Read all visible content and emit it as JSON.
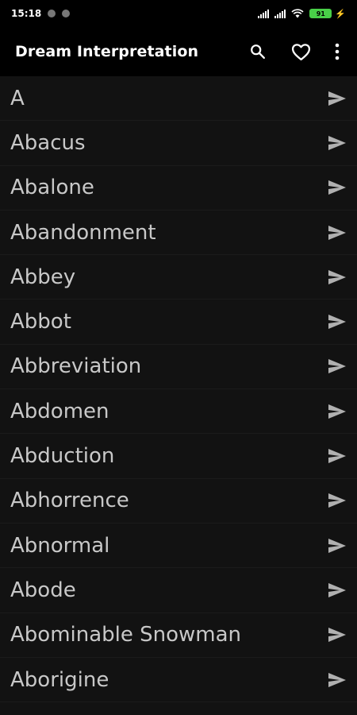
{
  "status_bar": {
    "time": "15:18",
    "battery": "91",
    "icons": [
      "notification-dot-icon",
      "notification-dot-icon",
      "signal-icon",
      "signal-icon",
      "wifi-icon",
      "battery-icon",
      "charging-icon"
    ]
  },
  "app_bar": {
    "title": "Dream Interpretation",
    "actions": [
      "search-icon",
      "heart-icon",
      "more-vert-icon"
    ]
  },
  "list": {
    "items": [
      {
        "label": "A"
      },
      {
        "label": "Abacus"
      },
      {
        "label": "Abalone"
      },
      {
        "label": "Abandonment"
      },
      {
        "label": "Abbey"
      },
      {
        "label": "Abbot"
      },
      {
        "label": "Abbreviation"
      },
      {
        "label": "Abdomen"
      },
      {
        "label": "Abduction"
      },
      {
        "label": "Abhorrence"
      },
      {
        "label": "Abnormal"
      },
      {
        "label": "Abode"
      },
      {
        "label": "Abominable Snowman"
      },
      {
        "label": "Aborigine"
      }
    ]
  },
  "colors": {
    "background": "#121212",
    "app_bar": "#000000",
    "text": "#c8c8c8",
    "arrow": "#b0b0b0",
    "battery": "#49d048"
  }
}
